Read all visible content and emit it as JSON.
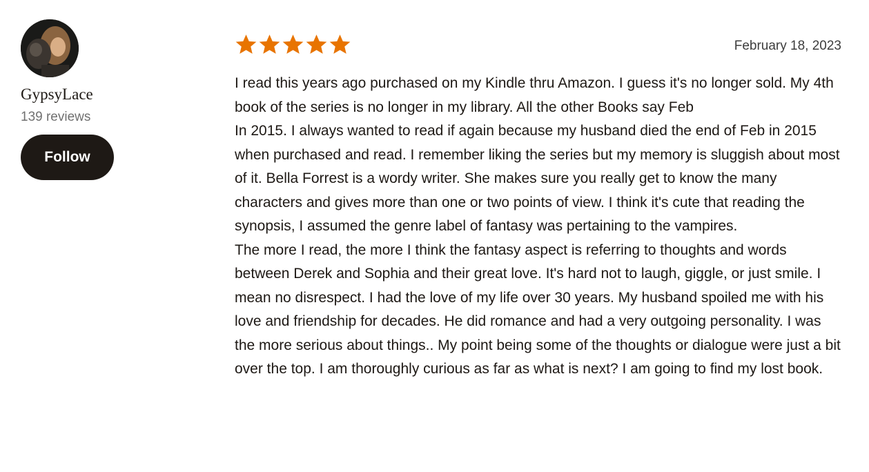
{
  "reviewer": {
    "avatar_icon": "user-avatar-photo",
    "name": "GypsyLace",
    "review_count": "139 reviews",
    "follow_label": "Follow"
  },
  "review": {
    "rating": 5,
    "max_rating": 5,
    "star_color": "#e87400",
    "date": "February 18, 2023",
    "paragraphs": [
      "I read this years ago purchased on my Kindle thru Amazon. I guess it's no longer sold. My 4th book of the series is no longer in my library. All the other Books say Feb",
      "In 2015. I always wanted to read if again because my husband died the end of Feb in 2015 when purchased and read. I remember liking the series but my memory is sluggish about most of it. Bella Forrest is a wordy writer. She makes sure you really get to know the many characters and gives more than one or two points of view. I think it's cute that reading the synopsis, I assumed the genre label of fantasy was pertaining to the vampires.",
      "The more I read, the more I think the fantasy aspect is referring to thoughts and words between Derek and Sophia and their great love. It's hard not to laugh, giggle, or just smile. I mean no disrespect. I had the love of my life over 30 years. My husband spoiled me with his love and friendship for decades. He did romance and had a very outgoing personality. I was the more serious about things.. My point being some of the thoughts or dialogue were just a bit over the top. I am thoroughly curious as far as what is next? I am going to find my lost book."
    ]
  }
}
